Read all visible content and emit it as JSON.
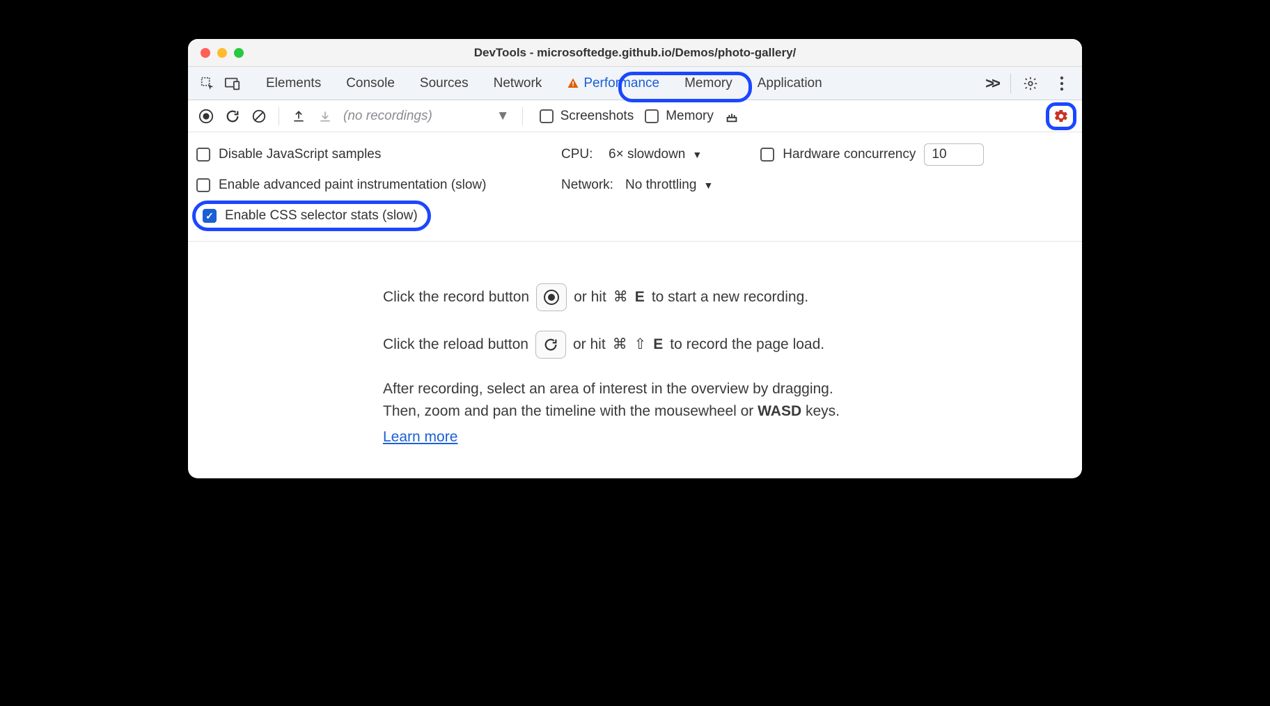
{
  "window": {
    "title": "DevTools - microsoftedge.github.io/Demos/photo-gallery/"
  },
  "tabs": {
    "items": [
      "Elements",
      "Console",
      "Sources",
      "Network",
      "Performance",
      "Memory",
      "Application"
    ],
    "active_index": 4,
    "overflow": ">>"
  },
  "toolbar2": {
    "recordings_placeholder": "(no recordings)",
    "screenshots_label": "Screenshots",
    "memory_label": "Memory"
  },
  "settings": {
    "disable_js_label": "Disable JavaScript samples",
    "disable_js_checked": false,
    "cpu_label": "CPU:",
    "cpu_value": "6× slowdown",
    "hw_label": "Hardware concurrency",
    "hw_checked": false,
    "hw_value": "10",
    "paint_label": "Enable advanced paint instrumentation (slow)",
    "paint_checked": false,
    "network_label": "Network:",
    "network_value": "No throttling",
    "css_label": "Enable CSS selector stats (slow)",
    "css_checked": true
  },
  "help": {
    "line1_a": "Click the record button",
    "line1_b": "or hit",
    "cmd": "⌘",
    "shift": "⇧",
    "key_e": "E",
    "line1_c": "to start a new recording.",
    "line2_a": "Click the reload button",
    "line2_b": "or hit",
    "line2_c": "to record the page load.",
    "para_a": "After recording, select an area of interest in the overview by dragging.",
    "para_b": "Then, zoom and pan the timeline with the mousewheel or ",
    "wasd": "WASD",
    "para_c": " keys.",
    "learn_more": "Learn more"
  }
}
